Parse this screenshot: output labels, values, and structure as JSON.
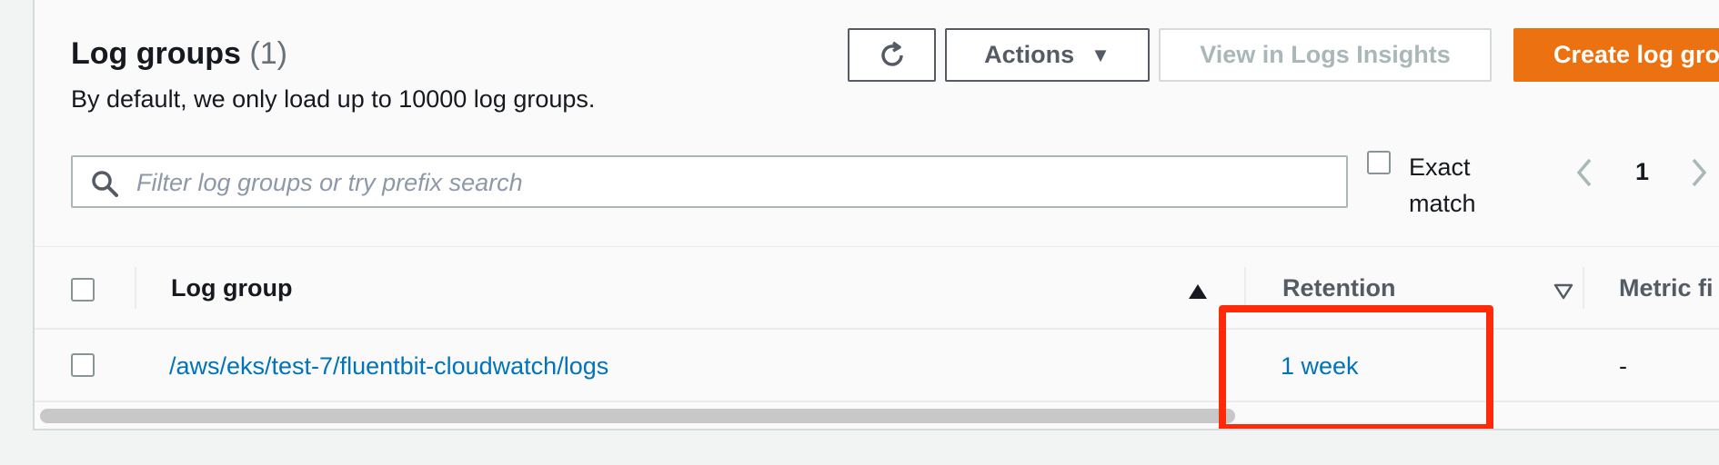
{
  "header": {
    "title": "Log groups",
    "count": "(1)",
    "subtitle": "By default, we only load up to 10000 log groups."
  },
  "toolbar": {
    "refresh_icon": "refresh-icon",
    "actions_label": "Actions",
    "actions_caret": "▼",
    "insights_label": "View in Logs Insights",
    "create_label": "Create log group"
  },
  "search": {
    "placeholder": "Filter log groups or try prefix search",
    "value": "",
    "icon": "search-icon"
  },
  "filter": {
    "exact_match_line1": "Exact",
    "exact_match_line2": "match",
    "exact_checked": false
  },
  "pagination": {
    "current_page": "1",
    "prev_icon": "chevron-left-icon",
    "next_icon": "chevron-right-icon"
  },
  "table": {
    "columns": [
      "Log group",
      "Retention",
      "Metric fi"
    ],
    "rows": [
      {
        "log_group": "/aws/eks/test-7/fluentbit-cloudwatch/logs",
        "retention": "1 week",
        "metric_filters": "-"
      }
    ]
  },
  "colors": {
    "link": "#0073bb",
    "primary": "#ec7211",
    "highlight": "#ff2a0a"
  }
}
